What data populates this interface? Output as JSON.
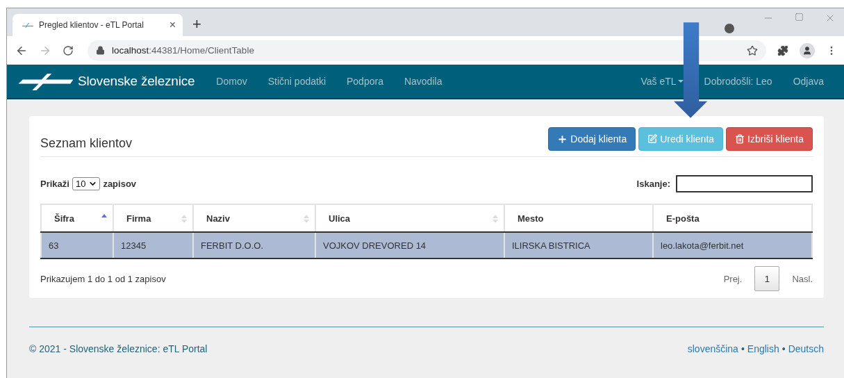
{
  "browser": {
    "tab": {
      "title": "Pregled klientov - eTL Portal",
      "close": "×"
    },
    "new_tab": "+",
    "url": {
      "host": "localhost",
      "path": ":44381/Home/ClientTable"
    },
    "forward_disabled": true
  },
  "navbar": {
    "brand": "Slovenske železnice",
    "left": [
      {
        "label": "Domov"
      },
      {
        "label": "Stični podatki"
      },
      {
        "label": "Podpora"
      },
      {
        "label": "Navodila"
      }
    ],
    "right": [
      {
        "label": "Vaš eTL",
        "has_menu": true
      },
      {
        "label": "Dobrodošli: Leo",
        "has_menu": false
      },
      {
        "label": "Odjava",
        "has_menu": false
      }
    ]
  },
  "card": {
    "title": "Seznam klientov",
    "buttons": [
      {
        "kind": "add",
        "label": "Dodaj klienta"
      },
      {
        "kind": "edit",
        "label": "Uredi klienta"
      },
      {
        "kind": "delete",
        "label": "Izbriši klienta"
      }
    ],
    "length": {
      "before": "Prikaži",
      "value": "10",
      "after": "zapisov"
    },
    "search": {
      "label": "Iskanje:"
    },
    "table": {
      "columns": [
        {
          "label": "Šifra",
          "kind": "sorted"
        },
        {
          "label": "Firma",
          "kind": "sortable"
        },
        {
          "label": "Naziv",
          "kind": "sortable"
        },
        {
          "label": "Ulica",
          "kind": "sortable"
        },
        {
          "label": "Mesto",
          "kind": "plain"
        },
        {
          "label": "E-pošta",
          "kind": "plain"
        }
      ],
      "rows": [
        {
          "selected": true,
          "cells": [
            "63",
            "12345",
            "FERBIT D.O.O.",
            "VOJKOV DREVORED 14",
            "ILIRSKA BISTRICA",
            "leo.lakota@ferbit.net"
          ]
        }
      ]
    },
    "info": "Prikazujem 1 do 1 od 1 zapisov",
    "pagination": {
      "prev": "Prej.",
      "pages": [
        {
          "label": "1",
          "selected": true
        }
      ],
      "next": "Nasl."
    }
  },
  "footer": {
    "copyright": "© 2021 - Slovenske železnice: eTL Portal",
    "separator": "•",
    "languages": [
      "slovenščina",
      "English",
      "Deutsch"
    ]
  },
  "annotation": {
    "arrow": true
  }
}
